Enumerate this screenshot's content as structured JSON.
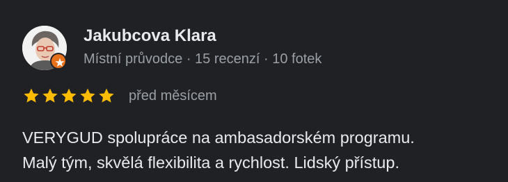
{
  "review": {
    "reviewer_name": "Jakubcova Klara",
    "reviewer_meta": "Místní průvodce · 15 recenzí · 10 fotek",
    "rating": 5,
    "rating_max": 5,
    "date": "před měsícem",
    "text_line1": "VERYGUD spolupráce na ambasadorském programu.",
    "text_line2": "Malý tým, skvělá flexibilita a rychlost. Lidský přístup."
  },
  "icons": {
    "avatar": "reviewer-photo",
    "badge": "local-guide-badge-icon",
    "star": "star-icon"
  },
  "colors": {
    "background": "#202124",
    "text_primary": "#e8eaed",
    "text_secondary": "#9aa0a6",
    "star": "#fbbc04",
    "badge": "#e8711c"
  }
}
